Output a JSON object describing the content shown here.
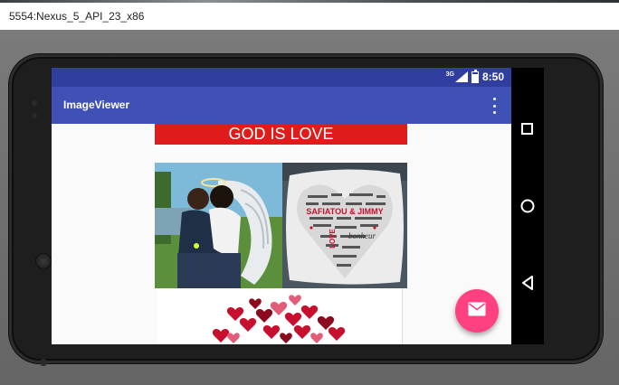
{
  "window": {
    "title": "5554:Nexus_5_API_23_x86"
  },
  "status_bar": {
    "network": "3G",
    "time": "8:50"
  },
  "app_bar": {
    "title": "ImageViewer",
    "overflow_icon": "more-vert-icon"
  },
  "content": {
    "banner_text": "GOD IS LOVE",
    "banner_color": "#e01b1b",
    "images": [
      {
        "name": "couple-angel-illustration"
      },
      {
        "name": "heart-word-cloud-pillow",
        "pillow_caption": "SAFIATOU & JIMMY"
      },
      {
        "name": "red-hearts-image"
      }
    ]
  },
  "navigation": {
    "recents_icon": "square-icon",
    "home_icon": "circle-icon",
    "back_icon": "triangle-back-icon"
  },
  "fab": {
    "icon": "email-icon",
    "color": "#ff4081"
  },
  "colors": {
    "primary": "#3f51b5",
    "primary_dark": "#303f9f",
    "accent": "#ff4081"
  }
}
